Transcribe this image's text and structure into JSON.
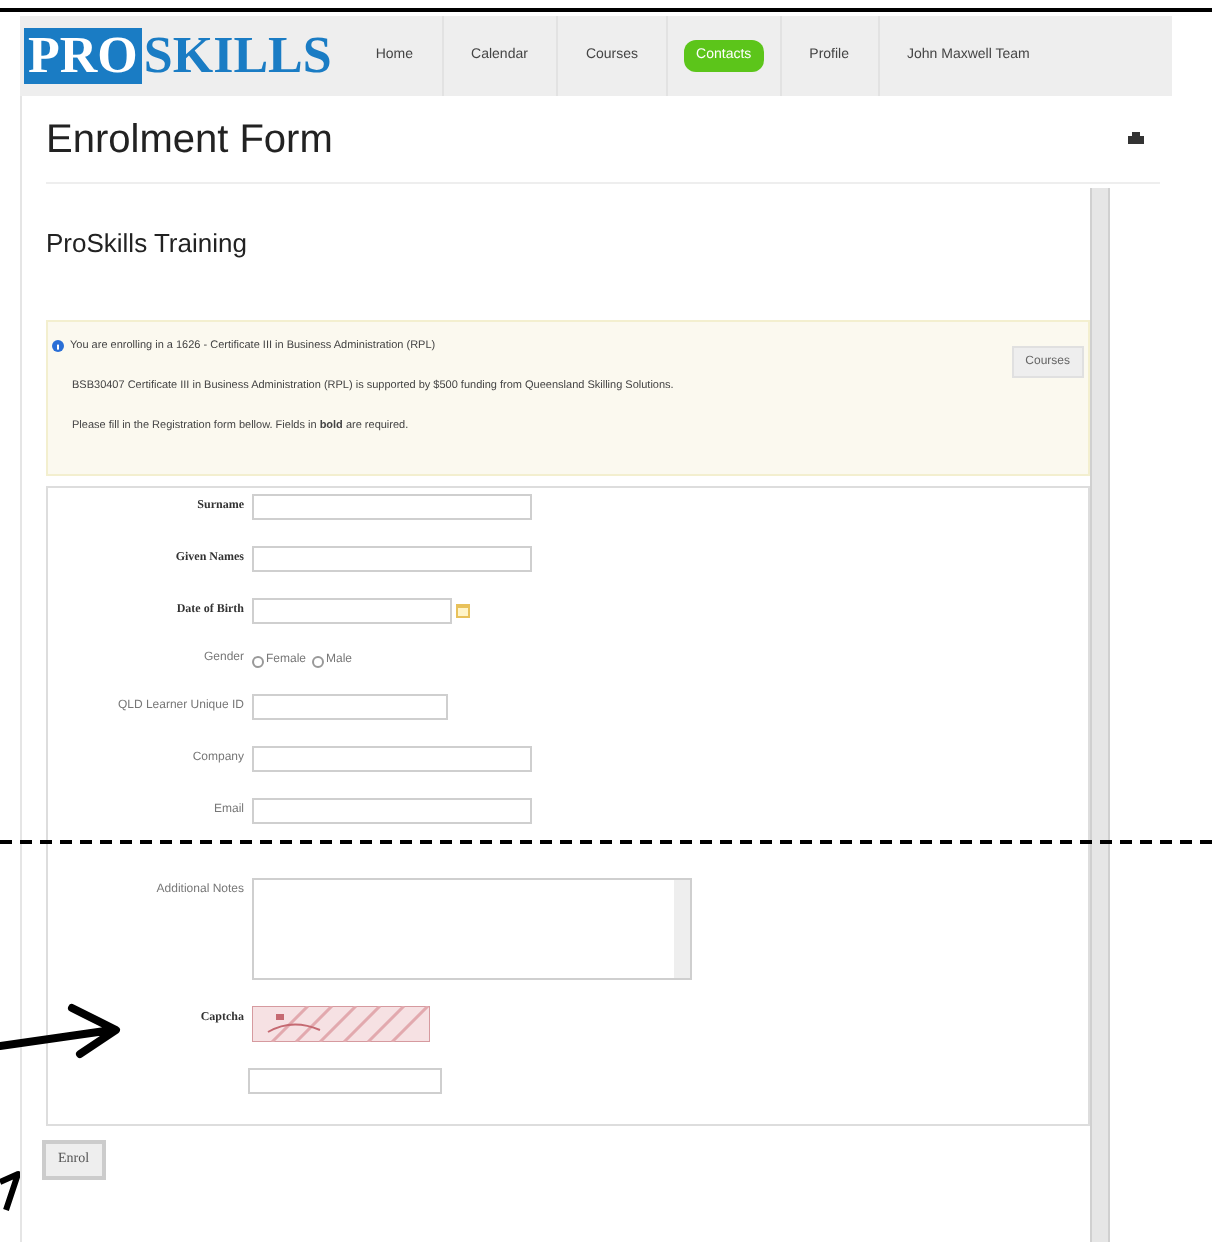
{
  "logo": {
    "boxed": "PRO",
    "plain": "SKILLS"
  },
  "nav": [
    {
      "label": "Home",
      "selected": false
    },
    {
      "label": "Calendar",
      "selected": false
    },
    {
      "label": "Courses",
      "selected": false
    },
    {
      "label": "Contacts",
      "selected": true
    },
    {
      "label": "Profile",
      "selected": false
    },
    {
      "label": "John Maxwell Team",
      "selected": false
    }
  ],
  "page_title": "Enrolment Form",
  "section_title": "ProSkills Training",
  "notice": {
    "lines": [
      "You are enrolling in a 1626 - Certificate III in Business Administration (RPL)",
      "BSB30407 Certificate III in Business Administration (RPL) is supported by $500 funding from Queensland Skilling Solutions.",
      "Please fill in the Registration form bellow. Fields in **bold** are required."
    ],
    "button": "Courses"
  },
  "fields": [
    {
      "kind": "text",
      "label": "Surname",
      "required": true
    },
    {
      "kind": "text",
      "label": "Given Names",
      "required": true
    },
    {
      "kind": "date",
      "label": "Date of Birth",
      "required": true
    },
    {
      "kind": "radio",
      "label": "Gender",
      "required": false,
      "options": [
        {
          "label": "Female",
          "selected": false
        },
        {
          "label": "Male",
          "selected": false
        }
      ]
    },
    {
      "kind": "short",
      "label": "QLD Learner Unique ID",
      "required": false
    },
    {
      "kind": "text",
      "label": "Company",
      "required": false
    },
    {
      "kind": "text",
      "label": "Email",
      "required": false
    },
    {
      "kind": "textarea",
      "label": "Additional Notes",
      "required": false
    },
    {
      "kind": "captcha",
      "label": "Captcha",
      "required": true
    }
  ],
  "submit": "Enrol"
}
